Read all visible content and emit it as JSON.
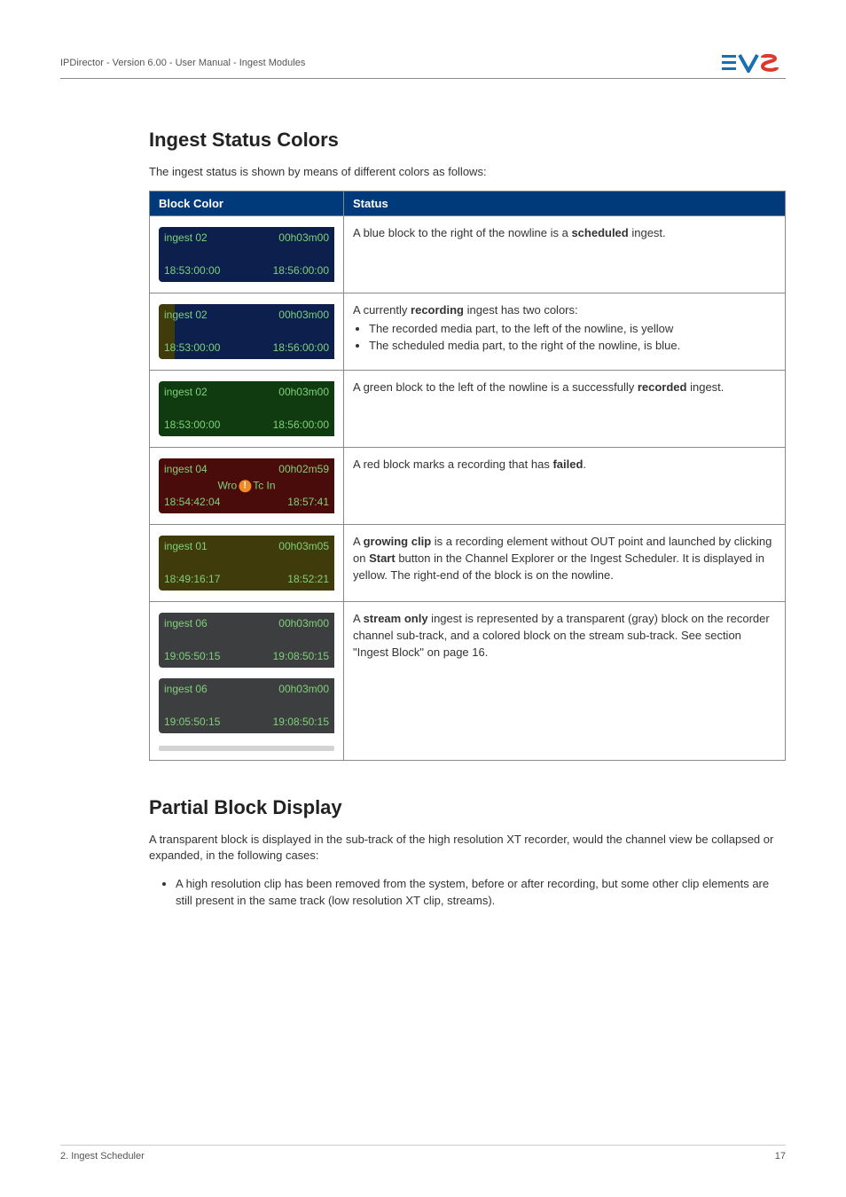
{
  "header": {
    "text": "IPDirector - Version 6.00 - User Manual - Ingest Modules"
  },
  "section1": {
    "heading": "Ingest Status Colors",
    "intro": "The ingest status is shown by means of different colors as follows:",
    "th1": "Block Color",
    "th2": "Status",
    "rows": [
      {
        "block": {
          "tl": "ingest 02",
          "tr": "00h03m00",
          "bl": "18:53:00:00",
          "br": "18:56:00:00"
        },
        "status_pre": "A blue block to the right of the nowline is a ",
        "status_bold": "scheduled",
        "status_post": " ingest."
      },
      {
        "block": {
          "tl": "ingest 02",
          "tr": "00h03m00",
          "bl": "18:53:00:00",
          "br": "18:56:00:00"
        },
        "status_pre": "A currently ",
        "status_bold": "recording",
        "status_post": " ingest has two colors:",
        "bullets": [
          "The recorded media part, to the left of the nowline, is yellow",
          "The scheduled media part, to the right of the nowline, is blue."
        ]
      },
      {
        "block": {
          "tl": "ingest 02",
          "tr": "00h03m00",
          "bl": "18:53:00:00",
          "br": "18:56:00:00"
        },
        "status_pre": "A green block to the left of the nowline is a successfully ",
        "status_bold": "recorded",
        "status_post": " ingest."
      },
      {
        "block": {
          "tl": "ingest 04",
          "tr": "00h02m59",
          "bl": "18:54:42:04",
          "br": "18:57:41",
          "cc_pre": "Wro",
          "cc_post": "Tc In"
        },
        "status_pre": "A red block marks a recording that has ",
        "status_bold": "failed",
        "status_post": "."
      },
      {
        "block": {
          "tl": "ingest 01",
          "tr": "00h03m05",
          "bl": "18:49:16:17",
          "br": "18:52:21"
        },
        "status_pre": "A ",
        "status_bold": "growing clip",
        "status_post": " is a recording element without OUT point and launched by clicking on ",
        "status_bold2": "Start",
        "status_post2": " button in the Channel Explorer or the Ingest Scheduler. It is displayed in yellow. The right-end of the block is on the nowline."
      },
      {
        "blocks": [
          {
            "tl": "ingest 06",
            "tr": "00h03m00",
            "bl": "19:05:50:15",
            "br": "19:08:50:15"
          },
          {
            "tl": "ingest 06",
            "tr": "00h03m00",
            "bl": "19:05:50:15",
            "br": "19:08:50:15"
          }
        ],
        "status_pre": "A ",
        "status_bold": "stream only",
        "status_post": " ingest is represented by a transparent (gray) block on the recorder channel sub-track, and a colored block on the stream sub-track. See section \"Ingest Block\" on page 16."
      }
    ]
  },
  "section2": {
    "heading": "Partial Block Display",
    "para": "A transparent block is displayed in the sub-track of the high resolution XT recorder, would the channel view be collapsed or expanded, in the following cases:",
    "bullet": "A high resolution clip has been removed from the system, before or after recording, but some other clip elements are still present in the same track (low resolution XT clip, streams)."
  },
  "footer": {
    "left": "2. Ingest Scheduler",
    "right": "17"
  }
}
